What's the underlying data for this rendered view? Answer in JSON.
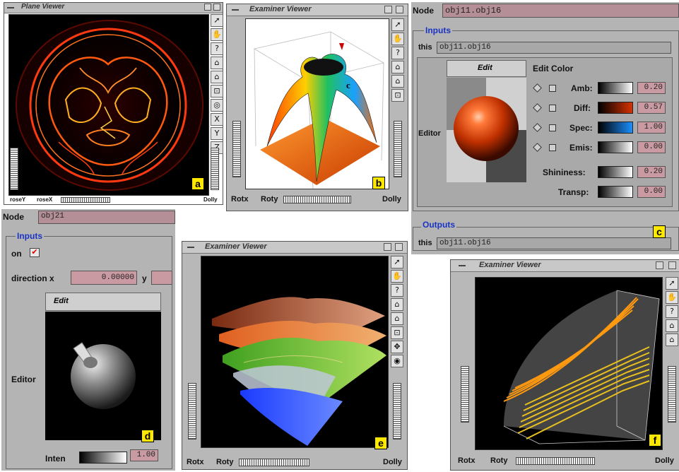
{
  "colors": {
    "window_bg": "#b8b8b8",
    "field_pink": "#b58f98",
    "section_blue": "#1a33c4",
    "badge_yellow": "#ffe800"
  },
  "badges": {
    "a": "a",
    "b": "b",
    "c": "c",
    "d": "d",
    "e": "e",
    "f": "f"
  },
  "panel_a": {
    "title": "Plane Viewer",
    "bottom_left_1": "roseY",
    "bottom_left_2": "roseX",
    "bottom_right": "Dolly",
    "tools": [
      "pointer-icon",
      "hand-icon",
      "question-icon",
      "home-icon",
      "set-home-icon",
      "view-all-icon",
      "seek-icon",
      "x-axis-icon",
      "y-axis-icon",
      "z-axis-icon"
    ]
  },
  "panel_b": {
    "title": "Examiner Viewer",
    "rotx": "Rotx",
    "roty": "Roty",
    "dolly": "Dolly",
    "annotation": "c",
    "tools": [
      "pointer-icon",
      "hand-icon",
      "question-icon",
      "home-icon",
      "set-home-icon",
      "view-all-icon"
    ]
  },
  "panel_c": {
    "node_label": "Node",
    "node_value": "obj11.obj16",
    "inputs_label": "Inputs",
    "this_label": "this",
    "this_value": "obj11.obj16",
    "edit_tab": "Edit",
    "edit_color_label": "Edit Color",
    "editor_label": "Editor",
    "rows": [
      {
        "label": "Amb:",
        "value": "0.20"
      },
      {
        "label": "Diff:",
        "value": "0.57"
      },
      {
        "label": "Spec:",
        "value": "1.00"
      },
      {
        "label": "Emis:",
        "value": "0.00"
      }
    ],
    "shininess_label": "Shininess:",
    "shininess_value": "0.20",
    "transp_label": "Transp:",
    "transp_value": "0.00",
    "outputs_label": "Outputs",
    "out_this_label": "this",
    "out_this_value": "obj11.obj16"
  },
  "panel_d": {
    "node_label": "Node",
    "node_value": "obj21",
    "inputs_label": "Inputs",
    "on_label": "on",
    "direction_label": "direction x",
    "x_value": "0.00000",
    "y_label": "y",
    "edit_tab": "Edit",
    "editor_label": "Editor",
    "inten_label": "Inten",
    "inten_value": "1.00"
  },
  "panel_e": {
    "title": "Examiner Viewer",
    "rotx": "Rotx",
    "roty": "Roty",
    "dolly": "Dolly",
    "tools": [
      "pointer-icon",
      "hand-icon",
      "question-icon",
      "home-icon",
      "set-home-icon",
      "view-all-icon",
      "seek-icon",
      "camera-icon"
    ]
  },
  "panel_f": {
    "title": "Examiner Viewer",
    "rotx": "Rotx",
    "roty": "Roty",
    "dolly": "Dolly",
    "tools": [
      "pointer-icon",
      "hand-icon",
      "question-icon",
      "home-icon",
      "set-home-icon"
    ]
  }
}
